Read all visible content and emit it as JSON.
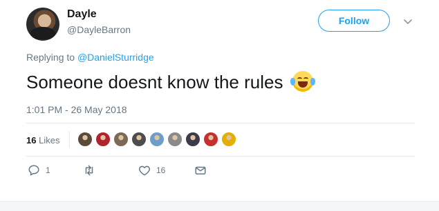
{
  "tweet": {
    "author_name": "Dayle",
    "author_handle": "@DayleBarron",
    "follow_label": "Follow",
    "reply_prefix": "Replying to ",
    "reply_mention": "@DanielSturridge",
    "text": "Someone doesnt know the rules",
    "emoji": "face-with-tears-of-joy",
    "timestamp": "1:01 PM - 26 May 2018"
  },
  "stats": {
    "likes_count": "16",
    "likes_label": "Likes",
    "likers": [
      {
        "color": "#5b4a3a"
      },
      {
        "color": "#b2242c"
      },
      {
        "color": "#7c6a56"
      },
      {
        "color": "#4d4d4d"
      },
      {
        "color": "#6d9ec9"
      },
      {
        "color": "#8a8a8a"
      },
      {
        "color": "#3d3a4a"
      },
      {
        "color": "#c8302f"
      },
      {
        "color": "#e2b000"
      }
    ]
  },
  "actions": {
    "reply_count": "1",
    "retweet_count": "",
    "like_count": "16",
    "dm_label": ""
  },
  "colors": {
    "accent": "#1da1f2",
    "text": "#14171a",
    "muted": "#657786",
    "border": "#e6ecf0"
  },
  "icons": [
    "caret-down-icon",
    "reply-icon",
    "retweet-icon",
    "heart-icon",
    "envelope-icon"
  ]
}
